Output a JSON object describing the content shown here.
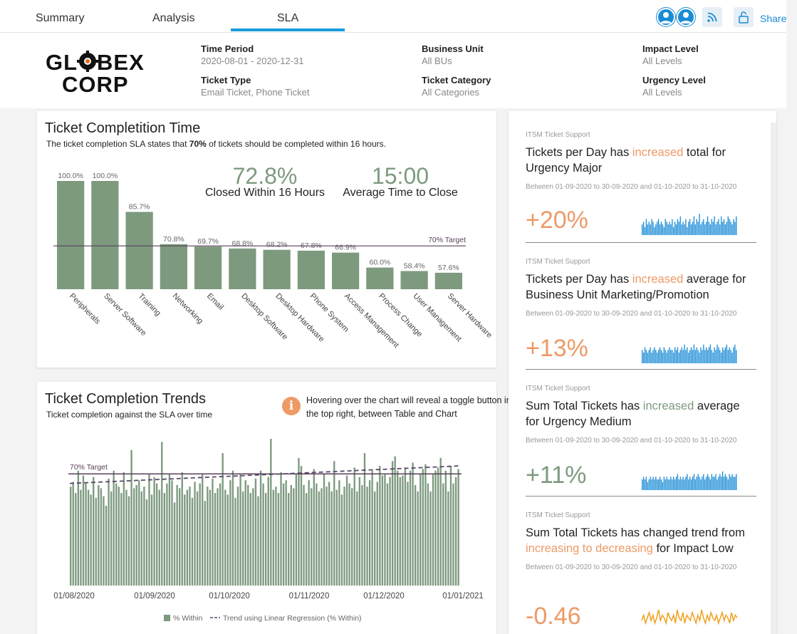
{
  "tabs": [
    {
      "label": "Summary"
    },
    {
      "label": "Analysis"
    },
    {
      "label": "SLA"
    }
  ],
  "share_label": "Share",
  "logo_text": [
    "GLOBEX",
    "CORP"
  ],
  "filters": {
    "time_period": {
      "label": "Time Period",
      "value": "2020-08-01 - 2020-12-31"
    },
    "business_unit": {
      "label": "Business Unit",
      "value": "All BUs"
    },
    "impact_level": {
      "label": "Impact Level",
      "value": "All Levels"
    },
    "ticket_type": {
      "label": "Ticket Type",
      "value": "Email Ticket, Phone Ticket"
    },
    "ticket_category": {
      "label": "Ticket Category",
      "value": "All Categories"
    },
    "urgency_level": {
      "label": "Urgency Level",
      "value": "All Levels"
    }
  },
  "completion_card": {
    "title": "Ticket Completition Time",
    "subtitle_pre": "The ticket completion SLA states that ",
    "subtitle_bold": "70%",
    "subtitle_post": " of tickets should be completed within 16 hours.",
    "kpi1_value": "72.8%",
    "kpi1_label": "Closed Within 16 Hours",
    "kpi2_value": "15:00",
    "kpi2_label": "Average Time to Close"
  },
  "trends_card": {
    "title": "Ticket Completion Trends",
    "subtitle": "Ticket completion against the SLA over time",
    "info": "Hovering over the chart will reveal a toggle button in the top right, between Table and Chart"
  },
  "chart_data": [
    {
      "type": "bar",
      "categories": [
        "Peripherals",
        "Server Software",
        "Training",
        "Networking",
        "Email",
        "Desktop Software",
        "Desktop Hardware",
        "Phone System",
        "Access Management",
        "Process Change",
        "User Management",
        "Server Hardware"
      ],
      "values": [
        100.0,
        100.0,
        85.7,
        70.8,
        69.7,
        68.8,
        68.2,
        67.8,
        66.9,
        60.0,
        58.4,
        57.6
      ],
      "value_labels": [
        "100.0%",
        "100.0%",
        "85.7%",
        "70.8%",
        "69.7%",
        "68.8%",
        "68.2%",
        "67.8%",
        "66.9%",
        "60.0%",
        "58.4%",
        "57.6%"
      ],
      "target": 70,
      "target_label": "70% Target",
      "ylim": [
        50,
        100
      ],
      "color": "#7d9a7f",
      "target_color": "#5a3f5a"
    },
    {
      "type": "bar",
      "x_ticks": [
        "01/08/2020",
        "01/09/2020",
        "01/10/2020",
        "01/11/2020",
        "01/12/2020",
        "01/01/2021"
      ],
      "target": 70,
      "target_label": "70% Target",
      "trend": {
        "start": 64,
        "end": 75
      },
      "ylim": [
        0,
        100
      ],
      "series": [
        {
          "name": "% Within",
          "values": [
            62,
            65,
            58,
            72,
            60,
            69,
            64,
            60,
            57,
            68,
            55,
            63,
            61,
            56,
            50,
            67,
            59,
            72,
            64,
            62,
            58,
            71,
            60,
            56,
            85,
            61,
            63,
            66,
            59,
            62,
            54,
            70,
            57,
            68,
            64,
            60,
            90,
            58,
            64,
            70,
            66,
            52,
            63,
            61,
            71,
            57,
            60,
            62,
            55,
            65,
            59,
            64,
            70,
            53,
            62,
            60,
            67,
            58,
            61,
            64,
            83,
            60,
            57,
            66,
            72,
            55,
            62,
            70,
            59,
            66,
            63,
            58,
            61,
            67,
            56,
            72,
            64,
            58,
            68,
            92,
            60,
            62,
            58,
            71,
            64,
            66,
            58,
            63,
            61,
            70,
            80,
            75,
            63,
            58,
            66,
            61,
            73,
            64,
            59,
            61,
            70,
            62,
            65,
            59,
            78,
            60,
            66,
            57,
            62,
            69,
            64,
            61,
            74,
            59,
            68,
            63,
            83,
            62,
            66,
            72,
            59,
            65,
            75,
            69,
            70,
            64,
            68,
            78,
            81,
            72,
            68,
            69,
            74,
            65,
            72,
            77,
            63,
            59,
            70,
            73,
            76,
            64,
            59,
            70,
            72,
            74,
            80,
            64,
            72,
            59,
            75,
            64,
            68,
            73
          ]
        },
        {
          "name": "Trend using Linear Regression (% Within)"
        }
      ],
      "legend": [
        "% Within",
        "Trend using Linear Regression (% Within)"
      ],
      "color": "#7d9a7f",
      "target_color": "#5a3f5a"
    }
  ],
  "insights": [
    {
      "source": "ITSM Ticket Support",
      "title_parts": [
        {
          "t": "Tickets per Day has "
        },
        {
          "t": "increased",
          "c": "o"
        },
        {
          "t": " total for Urgency Major"
        }
      ],
      "date": "Between 01-09-2020 to 30-09-2020 and 01-10-2020 to 31-10-2020",
      "value": "+20%",
      "value_color": "#ed9a66",
      "spark_color": "#1a8bd5",
      "spark": [
        4,
        5,
        3,
        6,
        4,
        5,
        4,
        6,
        5,
        3,
        4,
        5,
        6,
        4,
        5,
        4,
        3,
        6,
        5,
        4,
        5,
        4,
        6,
        3,
        5,
        4,
        6,
        5,
        7,
        4,
        5,
        4,
        6,
        3,
        5,
        6,
        4,
        5,
        7,
        4,
        6,
        5,
        8,
        4,
        5,
        6,
        4,
        5,
        7,
        5,
        4,
        6,
        5,
        7,
        4,
        5,
        6,
        4,
        7,
        5,
        6,
        4,
        5,
        7,
        6,
        5,
        4,
        6,
        5,
        7
      ]
    },
    {
      "source": "ITSM Ticket Support",
      "title_parts": [
        {
          "t": "Tickets per Day has "
        },
        {
          "t": "increased",
          "c": "o"
        },
        {
          "t": " average for Business Unit Marketing/Promotion"
        }
      ],
      "date": "Between 01-09-2020 to 30-09-2020 and 01-10-2020 to 31-10-2020",
      "value": "+13%",
      "value_color": "#ed9a66",
      "spark_color": "#1a8bd5",
      "spark": [
        5,
        4,
        6,
        5,
        4,
        5,
        6,
        4,
        5,
        6,
        5,
        4,
        5,
        6,
        5,
        4,
        6,
        5,
        4,
        5,
        6,
        5,
        5,
        4,
        6,
        5,
        6,
        4,
        5,
        6,
        5,
        7,
        5,
        6,
        4,
        5,
        6,
        5,
        7,
        5,
        6,
        5,
        4,
        6,
        5,
        7,
        5,
        6,
        5,
        6,
        7,
        5,
        4,
        6,
        5,
        7,
        6,
        5,
        4,
        6,
        5,
        6,
        7,
        5,
        6,
        5,
        4,
        6,
        7,
        5
      ]
    },
    {
      "source": "ITSM Ticket Support",
      "title_parts": [
        {
          "t": "Sum Total Tickets has "
        },
        {
          "t": "increased",
          "c": "g"
        },
        {
          "t": " average for Urgency Medium"
        }
      ],
      "date": "Between 01-09-2020 to 30-09-2020 and 01-10-2020 to 31-10-2020",
      "value": "+11%",
      "value_color": "#7d9a7f",
      "spark_color": "#1a8bd5",
      "spark": [
        4,
        5,
        4,
        5,
        3,
        4,
        5,
        4,
        5,
        4,
        5,
        4,
        4,
        5,
        4,
        3,
        5,
        4,
        5,
        4,
        4,
        5,
        4,
        5,
        4,
        5,
        6,
        4,
        5,
        4,
        5,
        4,
        5,
        6,
        4,
        5,
        4,
        5,
        6,
        4,
        5,
        6,
        5,
        4,
        5,
        6,
        4,
        5,
        6,
        5,
        4,
        6,
        5,
        5,
        6,
        4,
        5,
        6,
        5,
        7,
        5,
        6,
        5,
        4,
        6,
        5,
        6,
        5,
        5,
        6
      ]
    },
    {
      "source": "ITSM Ticket Support",
      "title_parts": [
        {
          "t": "Sum Total Tickets has changed trend from "
        },
        {
          "t": "increasing to decreasing",
          "c": "o"
        },
        {
          "t": " for Impact Low"
        }
      ],
      "date": "Between 01-09-2020 to 30-09-2020 and 01-10-2020 to 31-10-2020",
      "value": "-0.46",
      "value_color": "#ed9a66",
      "spark_color": "#f0a020",
      "spark": [
        4,
        6,
        3,
        5,
        7,
        4,
        6,
        3,
        5,
        8,
        4,
        6,
        5,
        3,
        7,
        5,
        4,
        6,
        3,
        8,
        5,
        4,
        7,
        3,
        6,
        5,
        4,
        7,
        5,
        3,
        6,
        4,
        8,
        5,
        3,
        6,
        4,
        7,
        5,
        4,
        6,
        3,
        5,
        7,
        4,
        6,
        5,
        3,
        7,
        4,
        6,
        5
      ]
    }
  ]
}
